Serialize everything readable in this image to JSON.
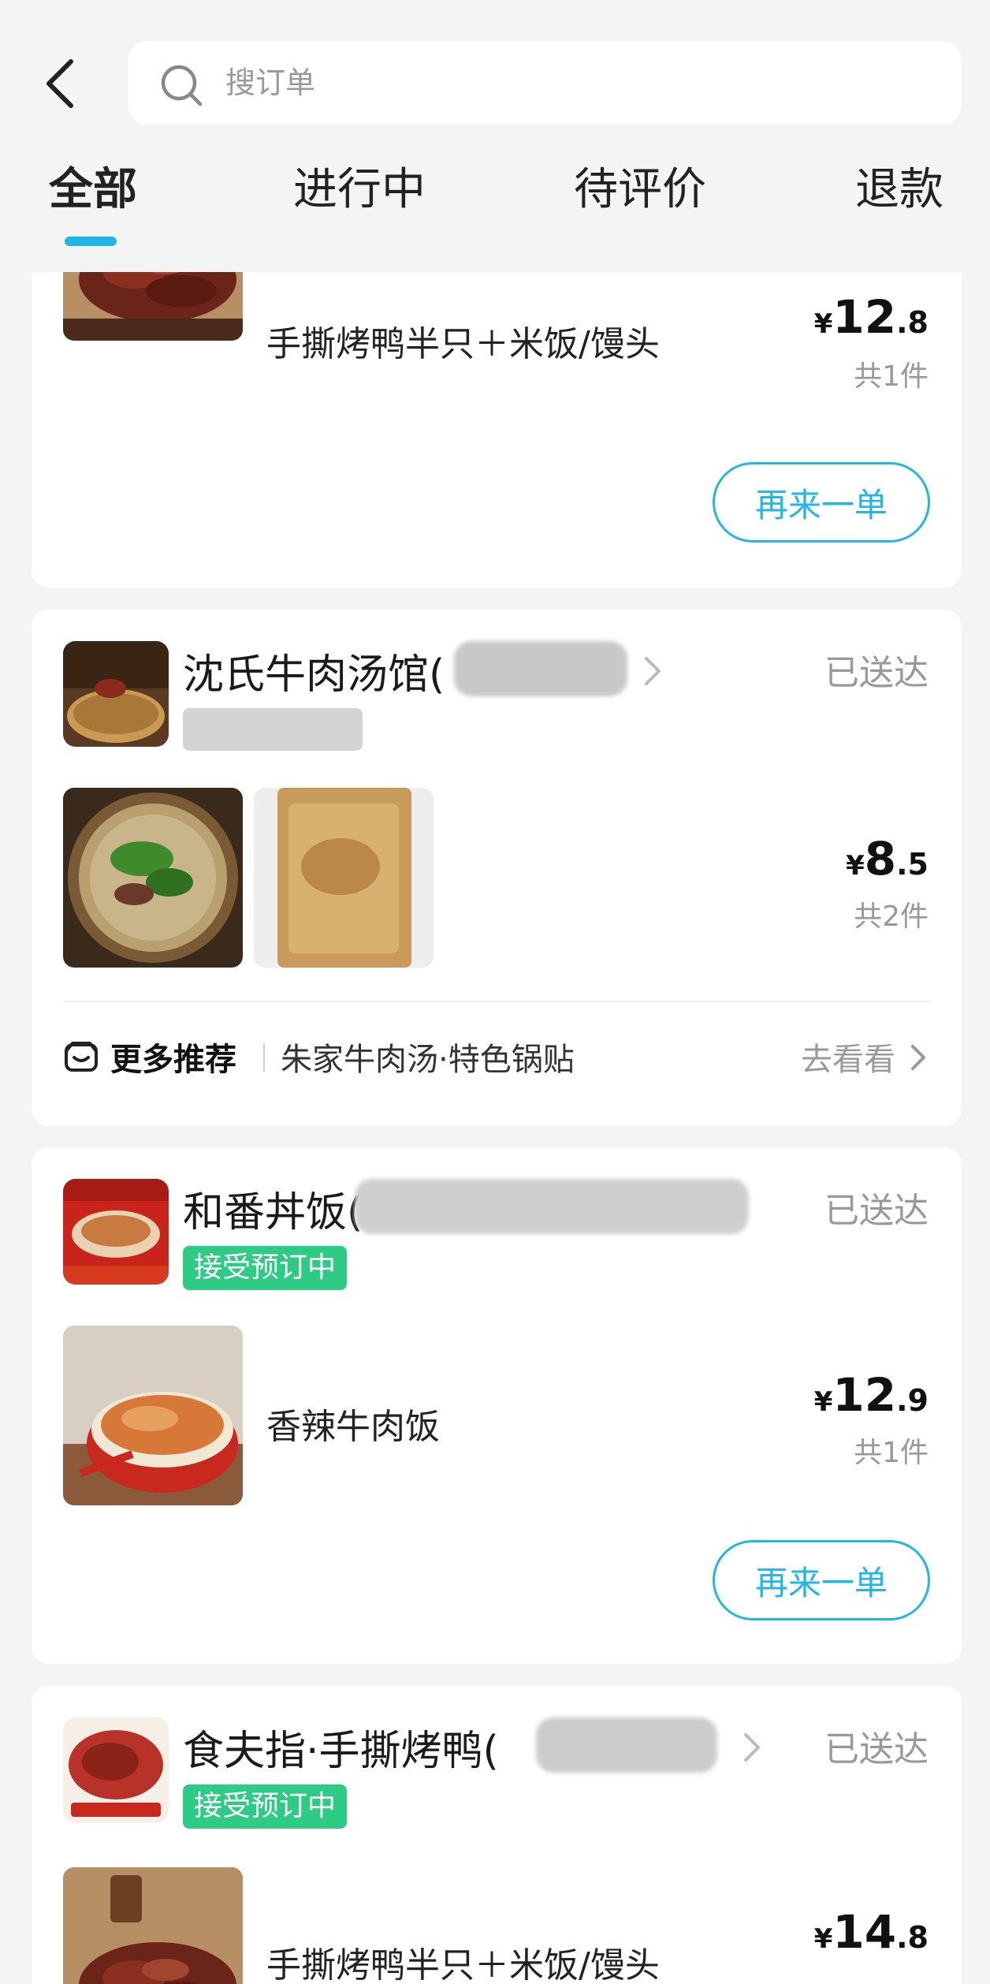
{
  "header": {
    "search": {
      "placeholder": "搜订单"
    },
    "tabs": [
      {
        "label": "全部",
        "active": true
      },
      {
        "label": "进行中",
        "active": false
      },
      {
        "label": "待评价",
        "active": false
      },
      {
        "label": "退款",
        "active": false
      }
    ]
  },
  "colors": {
    "accent": "#21b6e8",
    "tag_green": "#2ecb84",
    "page_bg": "#f4f4f4"
  },
  "orders": [
    {
      "item_name": "手撕烤鸭半只＋米饭/馒头",
      "price_currency": "¥",
      "price_integer": "12",
      "price_decimal": ".8",
      "count": "共1件",
      "action": "再来一单"
    },
    {
      "shop_name": "沈氏牛肉汤馆(",
      "status": "已送达",
      "price_currency": "¥",
      "price_integer": "8",
      "price_decimal": ".5",
      "count": "共2件",
      "recommend": {
        "title": "更多推荐",
        "description": "朱家牛肉汤·特色锅贴",
        "link": "去看看"
      }
    },
    {
      "shop_name": "和番丼饭(",
      "status": "已送达",
      "tag": "接受预订中",
      "item_name": "香辣牛肉饭",
      "price_currency": "¥",
      "price_integer": "12",
      "price_decimal": ".9",
      "count": "共1件",
      "action": "再来一单"
    },
    {
      "shop_name": "食夫指·手撕烤鸭(",
      "status": "已送达",
      "tag": "接受预订中",
      "item_name": "手撕烤鸭半只＋米饭/馒头",
      "price_currency": "¥",
      "price_integer": "14",
      "price_decimal": ".8"
    }
  ]
}
